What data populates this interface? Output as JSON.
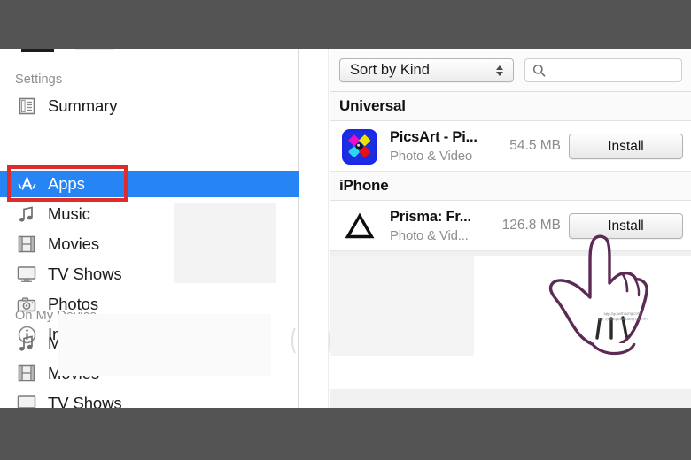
{
  "app": {
    "name": "iTunes Apps panel"
  },
  "sidebar": {
    "sections": [
      {
        "title": "Settings"
      },
      {
        "title": "On My Device"
      }
    ],
    "settings_items": [
      {
        "label": "Summary",
        "icon": "summary-document-icon",
        "selected": false
      },
      {
        "label": "Apps",
        "icon": "app-store-icon",
        "selected": true
      },
      {
        "label": "Music",
        "icon": "music-note-icon",
        "selected": false
      },
      {
        "label": "Movies",
        "icon": "film-strip-icon",
        "selected": false
      },
      {
        "label": "TV Shows",
        "icon": "tv-monitor-icon",
        "selected": false
      },
      {
        "label": "Photos",
        "icon": "camera-icon",
        "selected": false
      },
      {
        "label": "Info",
        "icon": "info-circle-icon",
        "selected": false
      }
    ],
    "device_items": [
      {
        "label": "Music",
        "icon": "music-note-icon"
      },
      {
        "label": "Movies",
        "icon": "film-strip-icon"
      },
      {
        "label": "TV Shows",
        "icon": "tv-monitor-icon"
      }
    ],
    "selection_color": "#2684f5",
    "highlight_box_color": "#e02b2b"
  },
  "toolbar": {
    "sort_label": "Sort by Kind",
    "search_value": "",
    "search_placeholder": ""
  },
  "groups": [
    {
      "title": "Universal",
      "apps": [
        {
          "name": "PicsArt - Pi...",
          "category": "Photo & Video",
          "size": "54.5 MB",
          "install_label": "Install",
          "icon": "picsart-app-icon"
        }
      ]
    },
    {
      "title": "iPhone",
      "apps": [
        {
          "name": "Prisma: Fr...",
          "category": "Photo & Vid...",
          "size": "126.8 MB",
          "install_label": "Install",
          "icon": "prisma-triangle-icon"
        }
      ]
    }
  ],
  "overlay": {
    "cursor": "pointing-hand-icon",
    "watermark_line1": "http://quanthuong.com/",
    "watermark_line2": "FB: /com/quanthuong.com.vn"
  }
}
